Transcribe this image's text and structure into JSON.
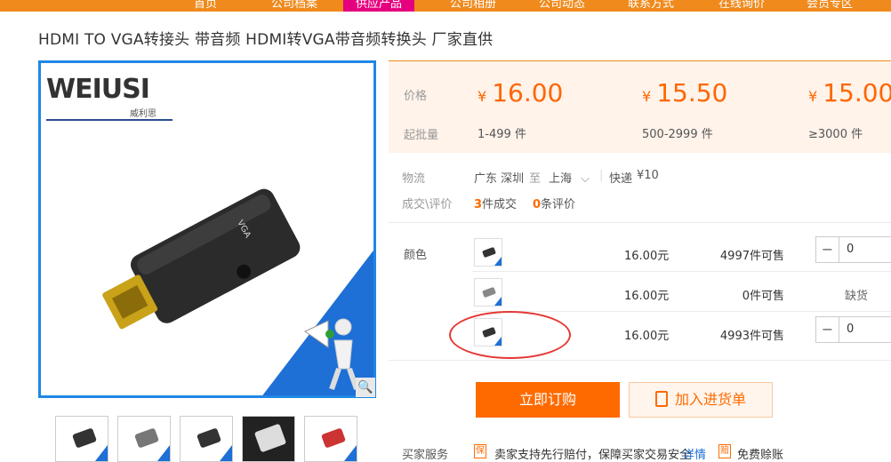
{
  "topnav": {
    "items": [
      "首页",
      "公司档案",
      "供应产品",
      "公司相册",
      "公司动态",
      "联系方式",
      "在线询价",
      "会员专区"
    ]
  },
  "product": {
    "title": "HDMI TO VGA转接头 带音频 HDMI转VGA带音频转换头 厂家直供",
    "logo_text": "WEIUSI",
    "logo_sub": "威利思"
  },
  "price": {
    "price_label": "价格",
    "qty_label": "起批量",
    "currency": "¥",
    "tiers": [
      {
        "price": "16.00",
        "qty": "1-499 件"
      },
      {
        "price": "15.50",
        "qty": "500-2999 件"
      },
      {
        "price": "15.00",
        "qty": "≥3000 件"
      }
    ]
  },
  "logistics": {
    "label": "物流",
    "from": "广东 深圳",
    "to_word": "至",
    "to": "上海",
    "method": "快递",
    "fee": "¥10"
  },
  "deals": {
    "label": "成交\\评价",
    "sold_count": "3",
    "sold_text": "件成交",
    "review_count": "0",
    "review_text": "条评价"
  },
  "variants": {
    "label": "颜色",
    "rows": [
      {
        "price": "16.00元",
        "stock": "4997件可售",
        "qty": "0",
        "out_of_stock": false
      },
      {
        "price": "16.00元",
        "stock": "0件可售",
        "out_label": "缺货",
        "out_of_stock": true
      },
      {
        "price": "16.00元",
        "stock": "4993件可售",
        "qty": "0",
        "out_of_stock": false
      }
    ]
  },
  "actions": {
    "buy_now": "立即订购",
    "add_cart": "加入进货单"
  },
  "services": {
    "label": "买家服务",
    "guarantee_icon": "保",
    "guarantee_text": "卖家支持先行赔付，保障买家交易安全",
    "detail_link": "详情",
    "compensate_icon": "赔",
    "compensate_text": "免费赊账"
  },
  "colors": {
    "accent": "#ff6a00",
    "nav": "#f08a1c",
    "nav_active": "#e5007f",
    "image_border": "#1e88e5"
  }
}
